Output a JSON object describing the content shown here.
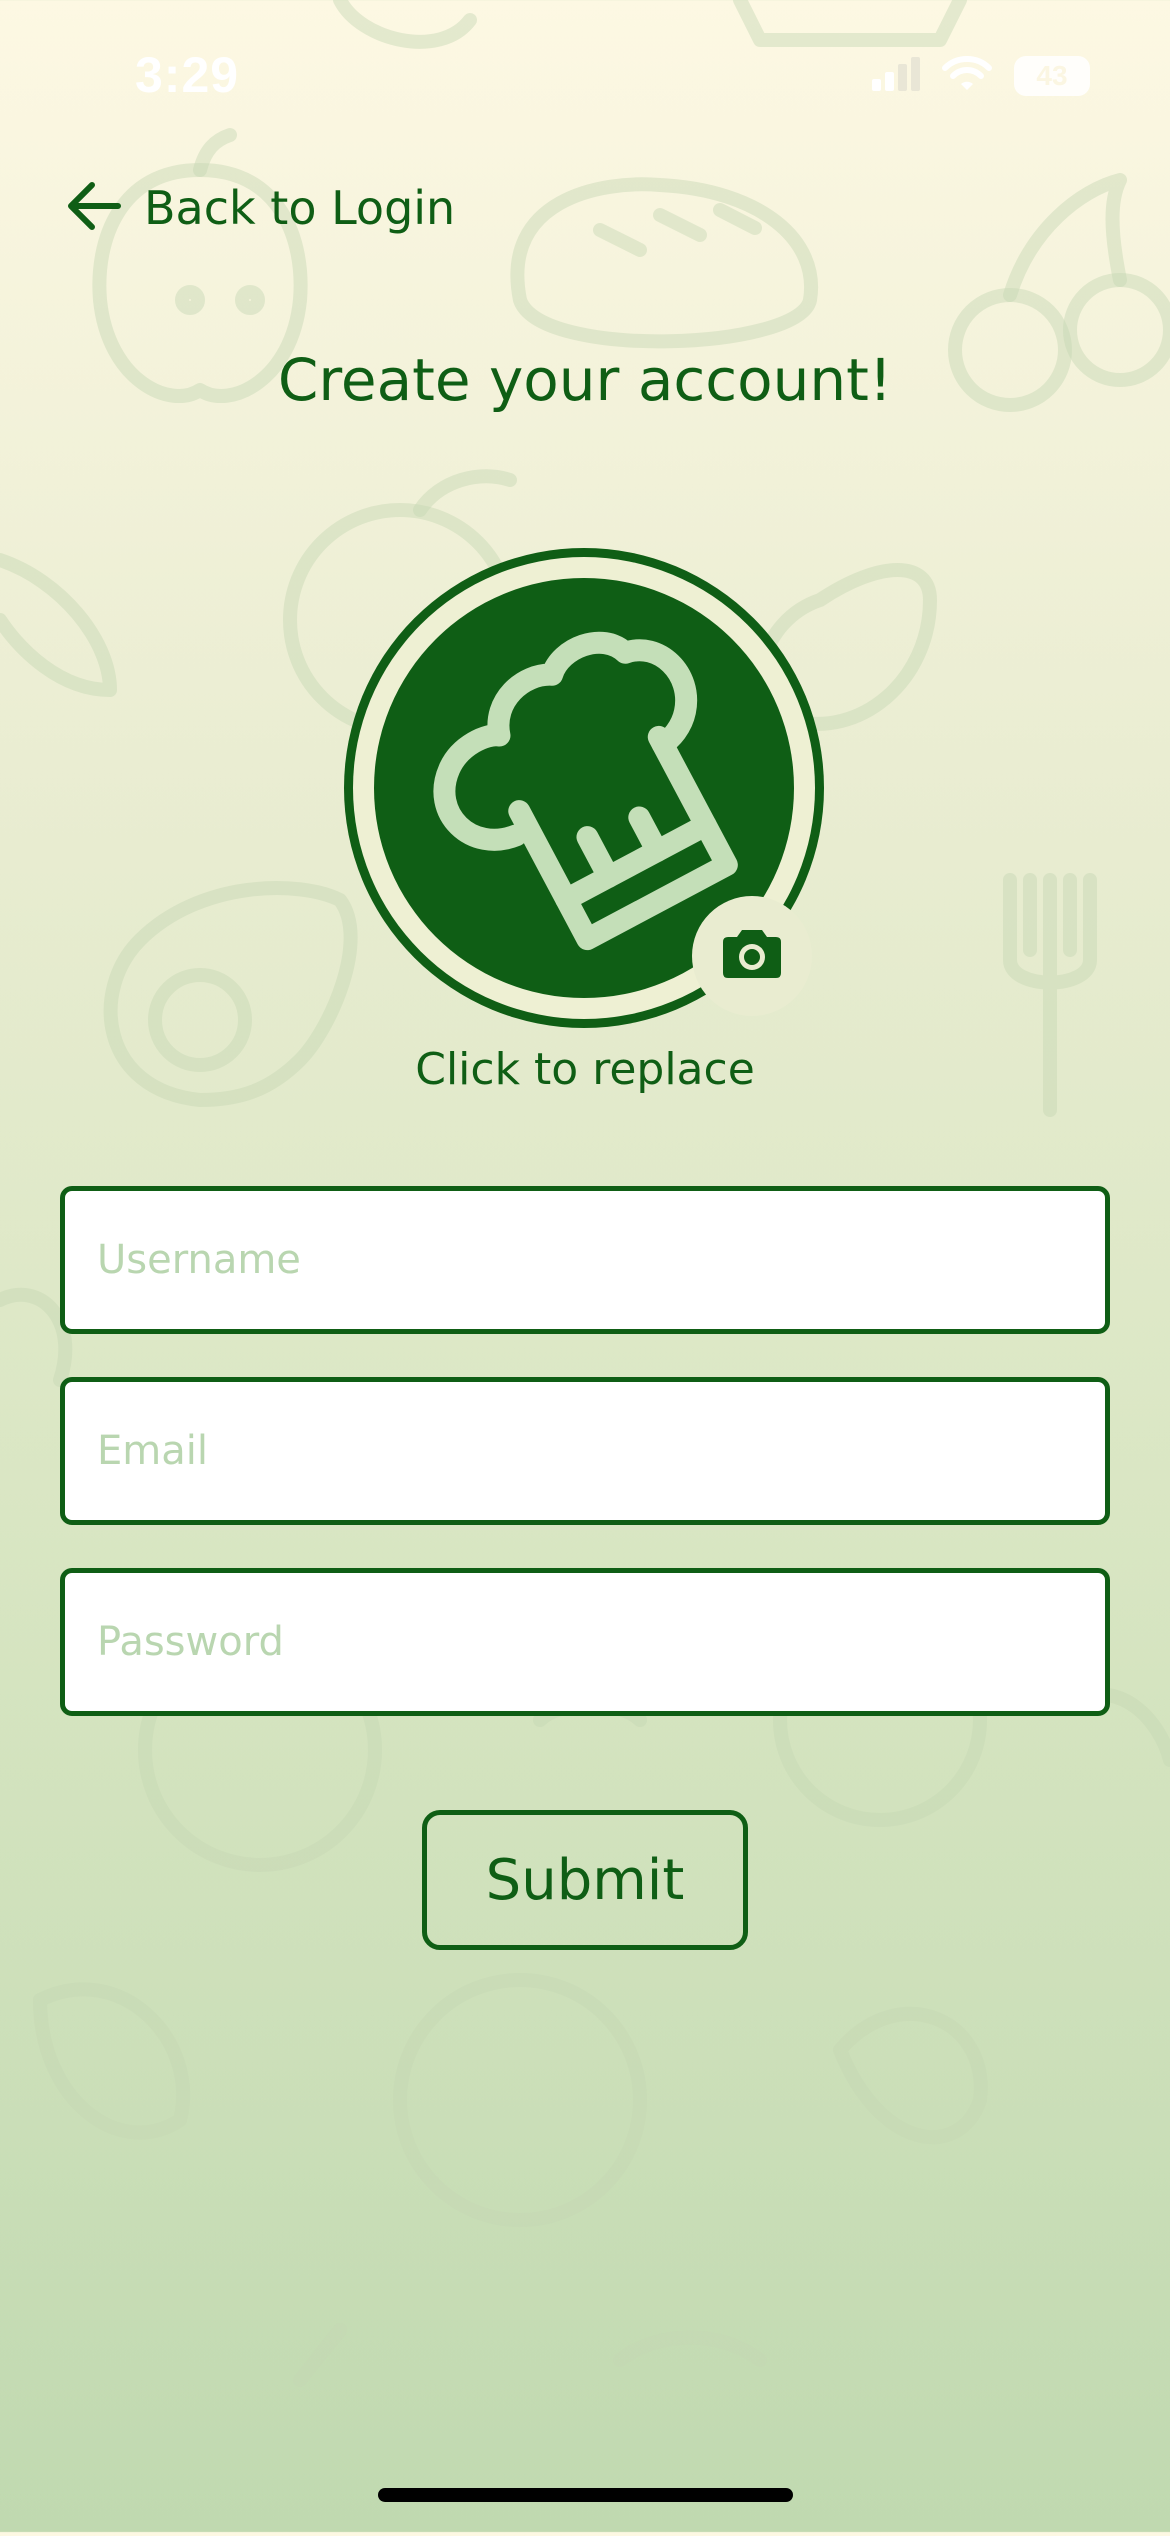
{
  "status_bar": {
    "time": "3:29",
    "battery": "43",
    "icons": [
      "cellular-signal-icon",
      "wifi-icon",
      "battery-icon"
    ]
  },
  "nav": {
    "back_label": "Back to Login",
    "back_icon": "arrow-left-icon"
  },
  "page": {
    "title": "Create your account!"
  },
  "avatar": {
    "image": "chef-hat-icon",
    "camera_icon": "camera-icon",
    "replace_label": "Click to replace"
  },
  "form": {
    "username": {
      "value": "",
      "placeholder": "Username"
    },
    "email": {
      "value": "",
      "placeholder": "Email"
    },
    "password": {
      "value": "",
      "placeholder": "Password"
    },
    "submit_label": "Submit"
  },
  "colors": {
    "primary": "#0f5e15",
    "placeholder": "#b9d6b0",
    "background_top": "#fdf8e3",
    "background_bottom": "#c0d9b0"
  }
}
